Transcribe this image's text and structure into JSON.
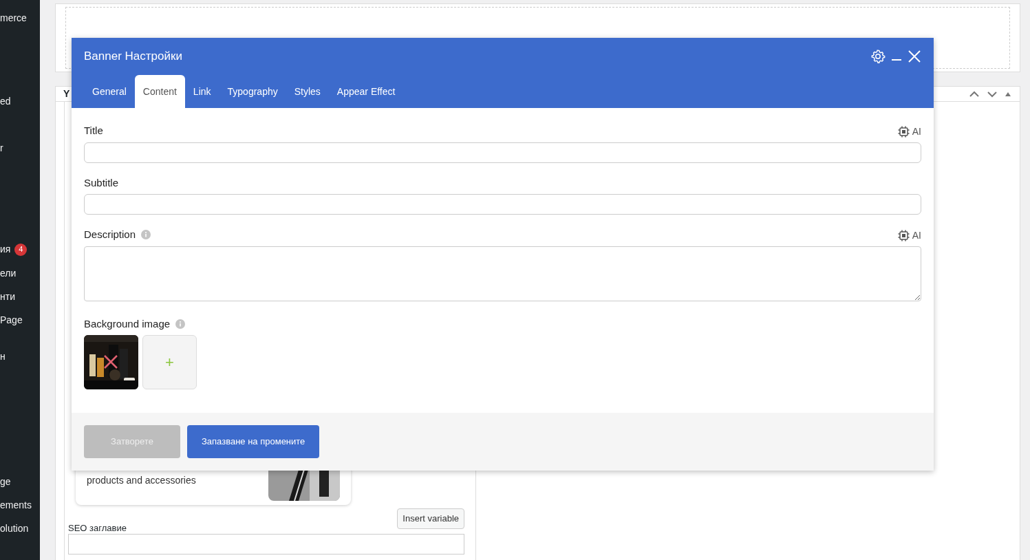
{
  "sidebar": {
    "items": [
      {
        "label": "merce"
      },
      {
        "label": "ed"
      },
      {
        "label": "r"
      },
      {
        "label": "ия",
        "badge": "4"
      },
      {
        "label": "ели"
      },
      {
        "label": "нти"
      },
      {
        "label": "Page"
      },
      {
        "label": "н"
      },
      {
        "label": "ge"
      },
      {
        "label": "ements"
      },
      {
        "label": "olution"
      }
    ]
  },
  "page": {
    "panel_title": "Y",
    "card_text": "products and accessories",
    "seo_label": "SEO заглавие",
    "insert_variable": "Insert variable"
  },
  "dialog": {
    "title": "Banner Настройки",
    "tabs": [
      {
        "label": "General",
        "selected": false
      },
      {
        "label": "Content",
        "selected": true
      },
      {
        "label": "Link",
        "selected": false
      },
      {
        "label": "Typography",
        "selected": false
      },
      {
        "label": "Styles",
        "selected": false
      },
      {
        "label": "Appear Effect",
        "selected": false
      }
    ],
    "fields": [
      {
        "kind": "input",
        "label": "Title",
        "ai": "AI"
      },
      {
        "kind": "input",
        "label": "Subtitle"
      },
      {
        "kind": "textarea",
        "label": "Description",
        "info": true,
        "ai": "AI"
      },
      {
        "label": "Background image",
        "info": true,
        "add": "+"
      }
    ],
    "buttons": [
      {
        "label": "Затворете",
        "kind": "secondary"
      },
      {
        "label": "Запазване на промените",
        "kind": "primary"
      }
    ]
  }
}
